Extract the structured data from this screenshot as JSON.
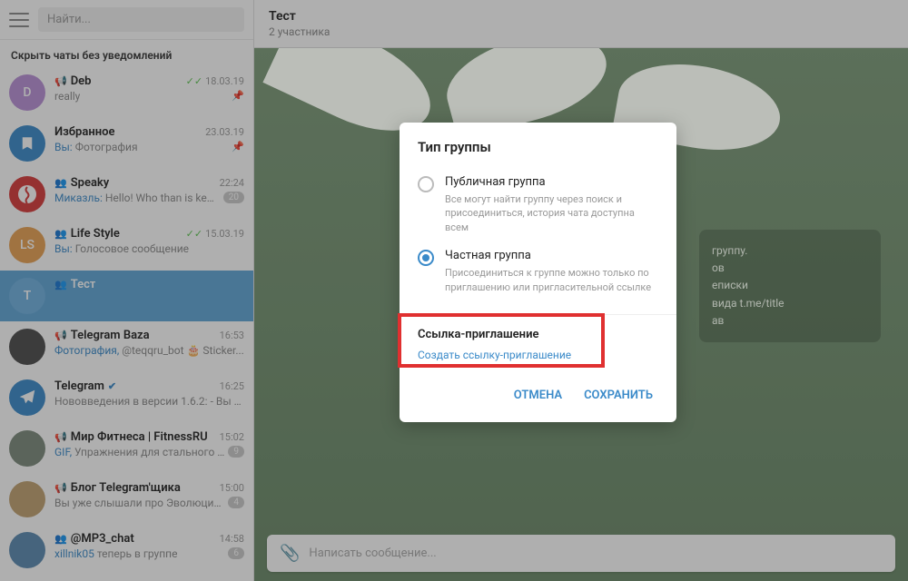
{
  "sidebar": {
    "search_placeholder": "Найти...",
    "section_title": "Скрыть чаты без уведомлений",
    "chats": [
      {
        "avatar_letter": "D",
        "avatar_color": "#b98fd6",
        "type": "channel",
        "name": "Deb",
        "time": "18.03.19",
        "checks": true,
        "preview_text": "really",
        "pinned": true
      },
      {
        "avatar_letter": "",
        "avatar_color": "#3a8ac9",
        "bookmark": true,
        "name": "Избранное",
        "time": "23.03.19",
        "preview_prefix": "Вы: ",
        "preview_text": "Фотография",
        "pinned": true
      },
      {
        "avatar_letter": "",
        "avatar_color": "#d63a3a",
        "speaky": true,
        "type": "group",
        "name": "Speaky",
        "time": "22:24",
        "preview_blue": "Миказль: ",
        "preview_text": "Hello! Who than is keen...",
        "badge": "20"
      },
      {
        "avatar_letter": "LS",
        "avatar_color": "#e8a052",
        "type": "group",
        "name": "Life Style",
        "time": "15.03.19",
        "checks": true,
        "preview_prefix": "Вы: ",
        "preview_text": "Голосовое сообщение"
      },
      {
        "avatar_letter": "T",
        "avatar_color": "#6fb0e0",
        "type": "group",
        "name": "Тест",
        "active": true
      },
      {
        "avatar_letter": "",
        "avatar_color": "#4a4a4a",
        "type": "channel",
        "name": "Telegram Baza",
        "time": "16:53",
        "preview_blue": "Фотография, ",
        "preview_text": "@teqqru_bot 🎂 Sticker..."
      },
      {
        "avatar_letter": "",
        "avatar_color": "#3a8ac9",
        "telegram": true,
        "name": "Telegram",
        "verified": true,
        "time": "16:25",
        "preview_text": "Нововведения в версии 1.6.2: - Вы м..."
      },
      {
        "avatar_letter": "",
        "avatar_color": "#7a8a7a",
        "type": "channel",
        "name": "Мир Фитнеса | FitnessRU",
        "time": "15:02",
        "preview_blue": "GIF, ",
        "preview_text": "Упражнения для стального ...",
        "badge": "9"
      },
      {
        "avatar_letter": "",
        "avatar_color": "#c0a070",
        "type": "channel",
        "name": "Блог Telegram'щика",
        "time": "15:00",
        "preview_text": "Вы уже слышали про Эволюцию...",
        "badge": "4"
      },
      {
        "avatar_letter": "",
        "avatar_color": "#5a8ab0",
        "type": "group",
        "name": "@MP3_chat",
        "time": "14:58",
        "preview_blue": "xillnik05 ",
        "preview_text": "теперь в группе",
        "badge": "6"
      }
    ]
  },
  "main": {
    "title": "Тест",
    "subtitle": "2 участника",
    "info_lines": [
      "группу.",
      "ов",
      "еписки",
      "вида t.me/title",
      "ав"
    ],
    "composer_placeholder": "Написать сообщение..."
  },
  "dialog": {
    "title": "Тип группы",
    "options": [
      {
        "label": "Публичная группа",
        "desc": "Все могут найти группу через поиск и присоединиться, история чата доступна всем",
        "selected": false
      },
      {
        "label": "Частная группа",
        "desc": "Присоединиться к группе можно только по приглашению или пригласительной ссылке",
        "selected": true
      }
    ],
    "invite_title": "Ссылка-приглашение",
    "invite_link": "Создать ссылку-приглашение",
    "cancel": "ОТМЕНА",
    "save": "СОХРАНИТЬ"
  }
}
